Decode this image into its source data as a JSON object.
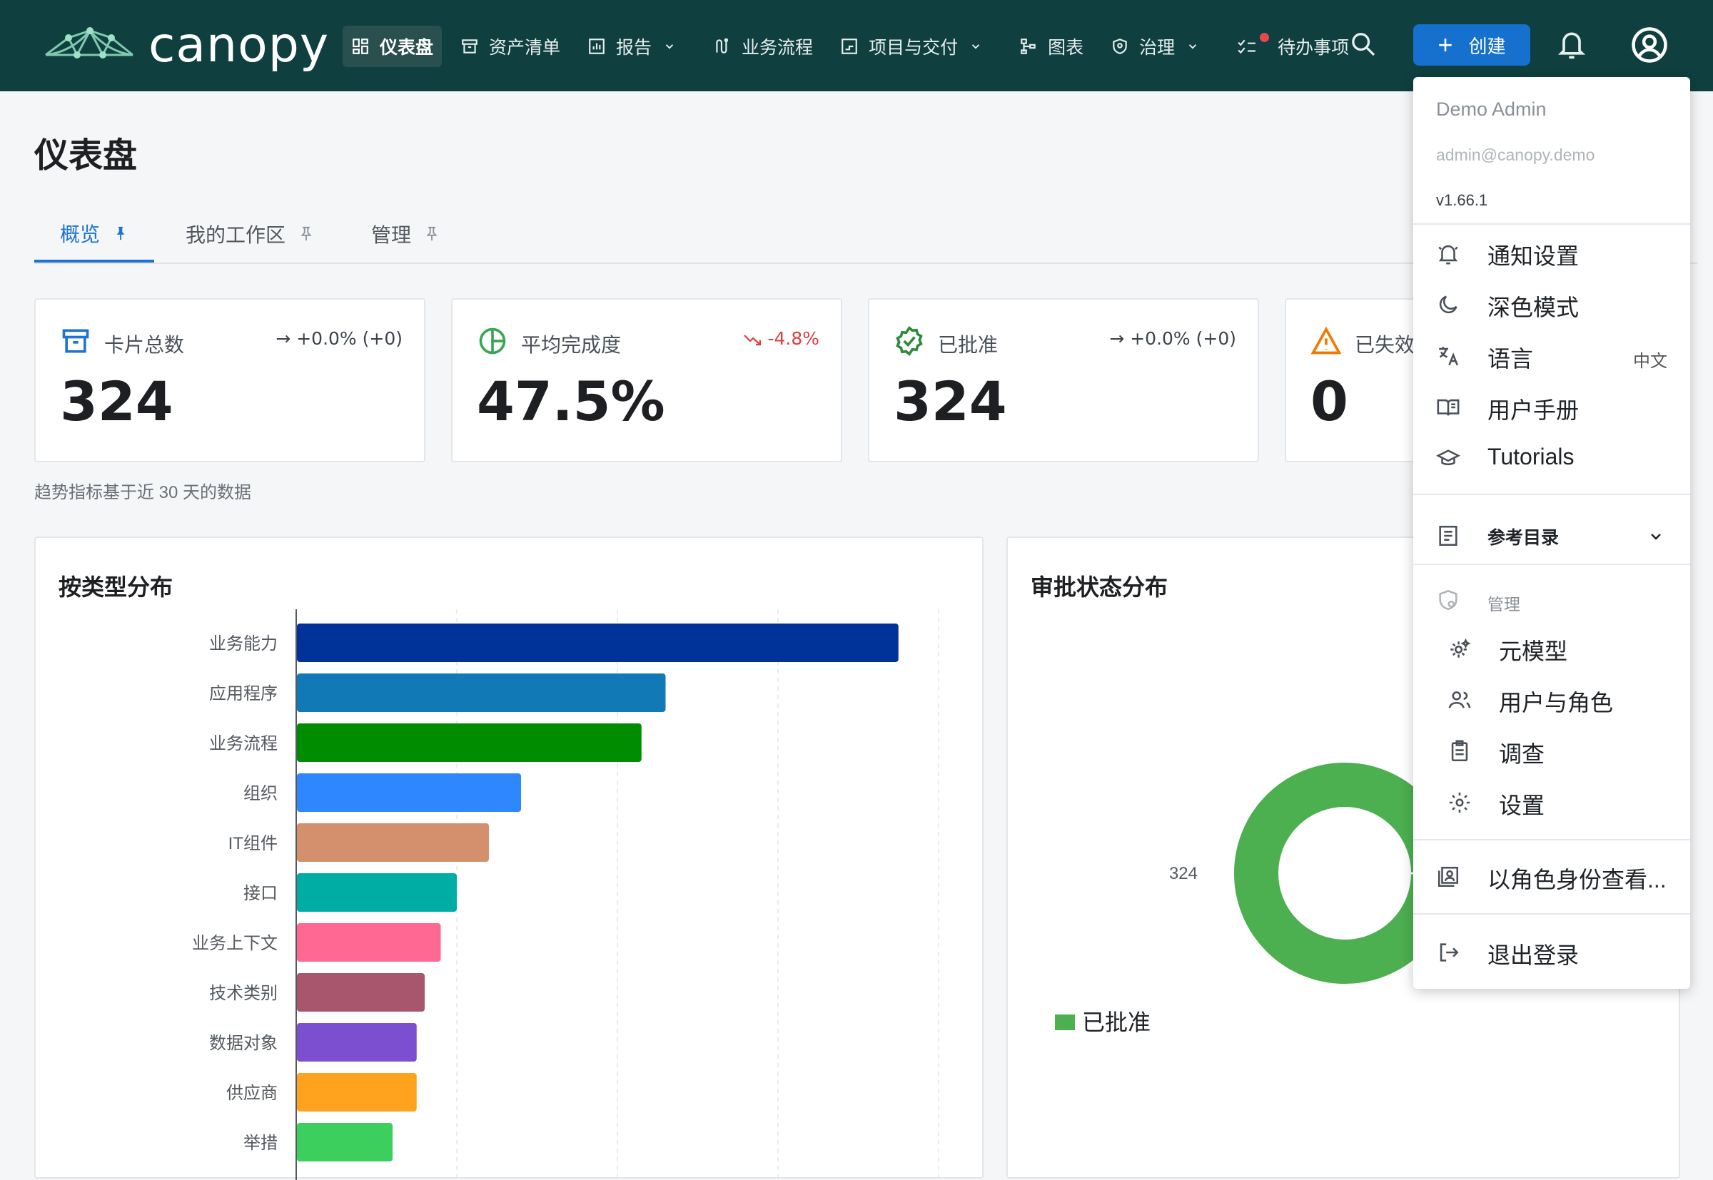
{
  "app": {
    "logo_text": "canopy"
  },
  "nav": {
    "items": [
      {
        "label": "仪表盘",
        "icon": "dashboard-icon"
      },
      {
        "label": "资产清单",
        "icon": "inventory-icon"
      },
      {
        "label": "报告",
        "icon": "report-icon"
      },
      {
        "label": "业务流程",
        "icon": "process-icon"
      },
      {
        "label": "项目与交付",
        "icon": "project-icon"
      },
      {
        "label": "图表",
        "icon": "diagram-icon"
      },
      {
        "label": "治理",
        "icon": "shield-icon"
      },
      {
        "label": "待办事项",
        "icon": "todo-icon"
      }
    ],
    "create_label": "创建"
  },
  "page": {
    "title": "仪表盘",
    "tabs": [
      {
        "label": "概览"
      },
      {
        "label": "我的工作区"
      },
      {
        "label": "管理"
      }
    ],
    "trend_note": "趋势指标基于近 30 天的数据"
  },
  "cards": [
    {
      "label": "卡片总数",
      "value": "324",
      "trend": "→ +0.0% (+0)"
    },
    {
      "label": "平均完成度",
      "value": "47.5%",
      "trend": "-4.8%"
    },
    {
      "label": "已批准",
      "value": "324",
      "trend": "→ +0.0% (+0)"
    },
    {
      "label": "已失效",
      "value": "0",
      "trend": ""
    }
  ],
  "panels": {
    "type_title": "按类型分布",
    "approval_title": "审批状态分布"
  },
  "chart_data": [
    {
      "type": "bar",
      "orientation": "horizontal",
      "title": "按类型分布",
      "categories": [
        "业务能力",
        "应用程序",
        "业务流程",
        "组织",
        "IT组件",
        "接口",
        "业务上下文",
        "技术类别",
        "数据对象",
        "供应商",
        "举措"
      ],
      "values": [
        75,
        46,
        43,
        28,
        24,
        20,
        18,
        16,
        15,
        15,
        12
      ],
      "colors": [
        "#003399",
        "#1179b5",
        "#008c00",
        "#2e87ff",
        "#d4906c",
        "#00ada4",
        "#ff6892",
        "#a8566e",
        "#7c4fd0",
        "#ffa31f",
        "#3ccf5e"
      ],
      "xlim": [
        0,
        80
      ],
      "grid": true
    },
    {
      "type": "pie",
      "variant": "donut",
      "title": "审批状态分布",
      "labels": [
        "已批准"
      ],
      "values": [
        324
      ],
      "colors": [
        "#4caf50"
      ],
      "legend": "bottom-left"
    }
  ],
  "user_menu": {
    "name": "Demo Admin",
    "email": "admin@canopy.demo",
    "version": "v1.66.1",
    "items": [
      {
        "label": "通知设置",
        "icon": "bell-settings-icon"
      },
      {
        "label": "深色模式",
        "icon": "moon-icon"
      },
      {
        "label": "语言",
        "icon": "translate-icon",
        "extra": "中文"
      },
      {
        "label": "用户手册",
        "icon": "book-icon"
      },
      {
        "label": "Tutorials",
        "icon": "graduation-cap-icon"
      }
    ],
    "reference": {
      "label": "参考目录",
      "icon": "catalog-icon"
    },
    "admin_header": "管理",
    "admin_items": [
      {
        "label": "元模型",
        "icon": "metamodel-icon"
      },
      {
        "label": "用户与角色",
        "icon": "users-icon"
      },
      {
        "label": "调查",
        "icon": "survey-icon"
      },
      {
        "label": "设置",
        "icon": "settings-gear-icon"
      }
    ],
    "view_as_role": "以角色身份查看...",
    "logout": "退出登录"
  }
}
